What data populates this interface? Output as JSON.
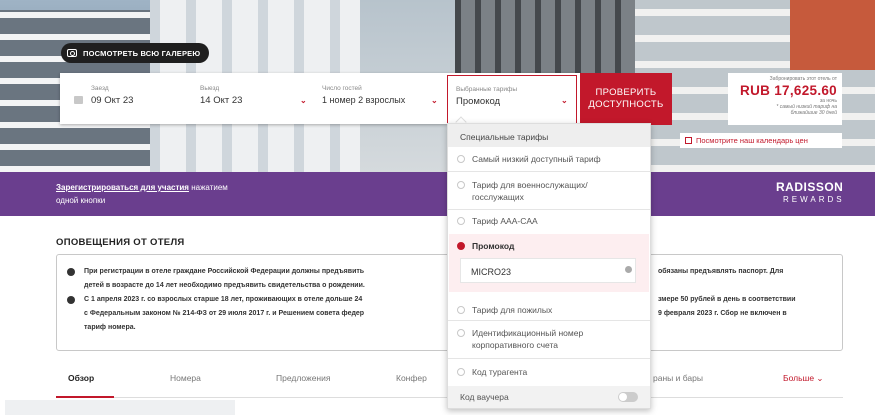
{
  "gallery_button": "ПОСМОТРЕТЬ ВСЮ ГАЛЕРЕЮ",
  "booking": {
    "checkin_label": "Заезд",
    "checkin_value": "09 Окт 23",
    "checkout_label": "Выезд",
    "checkout_value": "14 Окт 23",
    "guests_label": "Число гостей",
    "guests_value": "1 номер 2 взрослых",
    "tariffs_label": "Выбранные тарифы",
    "tariffs_value": "Промокод",
    "check_button_line1": "ПРОВЕРИТЬ",
    "check_button_line2": "ДОСТУПНОСТЬ"
  },
  "price": {
    "caption": "Забронировать этот отель от",
    "amount": "RUB 17,625.60",
    "per": "за ночь",
    "note1": "* самый низкий тариф на",
    "note2": "ближайшие 30 дней",
    "calendar_link": "Посмотрите наш календарь цен"
  },
  "rewards": {
    "link": "Зарегистрироваться для участия",
    "text1": " нажатием",
    "text2": "одной кнопки",
    "brand1": "RADISSON",
    "brand2": "REWARDS"
  },
  "alerts": {
    "title": "ОПОВЕЩЕНИЯ ОТ ОТЕЛЯ",
    "a1_l1": "При регистрации в отеле граждане Российской Федерации должны предъявить",
    "a1_r1": "обязаны предъявлять паспорт. Для",
    "a1_l2": "детей в возрасте до 14 лет необходимо предъявить свидетельства о рождении.",
    "a2_l1": "С 1 апреля 2023 г. со взрослых старше 18 лет, проживающих в отеле дольше 24",
    "a2_r1": "змере 50 рублей в день в соответствии",
    "a2_l2": "с Федеральным законом № 214-ФЗ от 29 июля 2017 г. и Решением совета федер",
    "a2_r2": "9 февраля 2023 г. Сбор не включен в",
    "a2_l3": "тариф номера."
  },
  "tabs": [
    "Обзор",
    "Номера",
    "Предложения",
    "Конфер",
    "раны и бары",
    "Больше ⌄"
  ],
  "dropdown": {
    "header": "Специальные тарифы",
    "options": [
      "Самый низкий доступный тариф",
      "Тариф для военнослужащих/",
      "госслужащих",
      "Тариф AAA-CAA",
      "Промокод",
      "Тариф для пожилых",
      "Идентификационный номер",
      "корпоративного счета",
      "Код турагента"
    ],
    "promo_code": "MICRO23",
    "voucher": "Код ваучера"
  },
  "colors": {
    "accent": "#c2182b",
    "purple": "#6a3e8e"
  }
}
